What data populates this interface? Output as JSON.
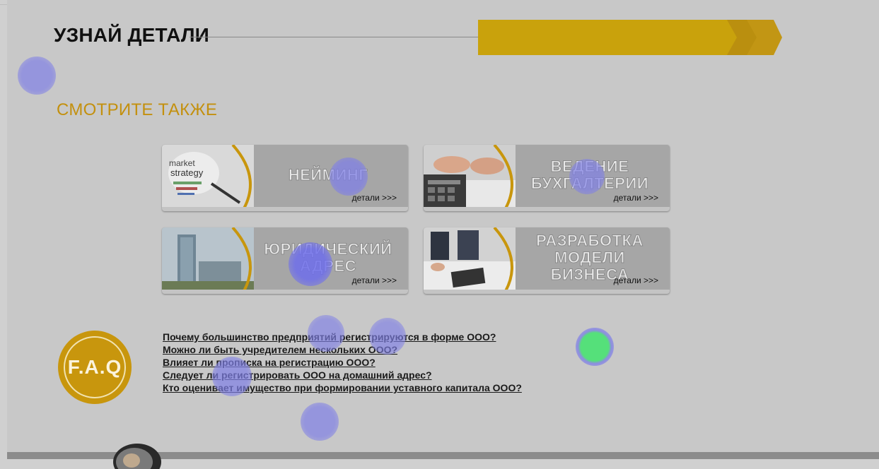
{
  "header": {
    "title": "УЗНАЙ ДЕТАЛИ"
  },
  "see_also": {
    "heading": "СМОТРИТЕ ТАКЖЕ"
  },
  "cards": [
    {
      "title": "НЕЙМИНГ",
      "more": "детали >>>",
      "thumb_icon": "marketing-strategy-image"
    },
    {
      "title": "ВЕДЕНИЕ\nБУХГАЛТЕРИИ",
      "more": "детали >>>",
      "thumb_icon": "calculator-hands-image"
    },
    {
      "title": "ЮРИДИЧЕСКИЙ\nАДРЕС",
      "more": "детали >>>",
      "thumb_icon": "office-building-image"
    },
    {
      "title": "РАЗРАБОТКА\nМОДЕЛИ БИЗНЕСА",
      "more": "детали >>>",
      "thumb_icon": "business-meeting-image"
    }
  ],
  "faq": {
    "badge": "F.A.Q",
    "questions": [
      "Почему большинство предприятий регистрируются в форме ООО?",
      "Можно ли быть учредителем нескольких ООО?",
      "Влияет ли прописка на регистрацию ООО?",
      "Следует ли регистрировать ООО на домашний адрес?",
      "Кто оценивает имущество при формировании уставного капитала ООО?"
    ]
  },
  "colors": {
    "accent_gold": "#c8960d",
    "ribbon_gold": "#c9a20c",
    "card_bg": "#a6a6a6",
    "gaze_blue": "#7f7fe6",
    "gaze_green": "#55e07a"
  }
}
